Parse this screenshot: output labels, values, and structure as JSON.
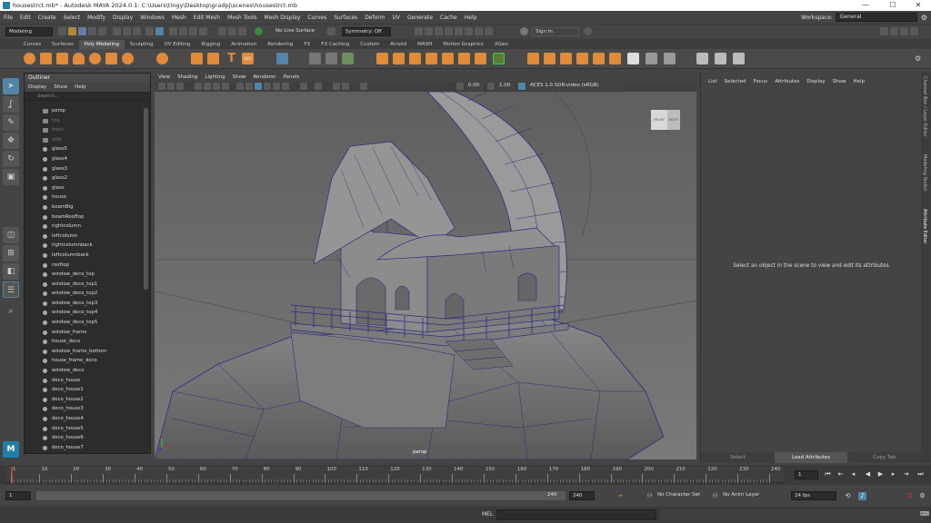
{
  "window": {
    "title": "housestrct.mb* - Autodesk MAYA 2024.0.1: C:\\Users\\tingy\\Desktop\\gradpj\\scenes\\housestrct.mb",
    "minimize": "—",
    "maximize": "☐",
    "close": "✕"
  },
  "menubar": [
    "File",
    "Edit",
    "Create",
    "Select",
    "Modify",
    "Display",
    "Windows",
    "Mesh",
    "Edit Mesh",
    "Mesh Tools",
    "Mesh Display",
    "Curves",
    "Surfaces",
    "Deform",
    "UV",
    "Generate",
    "Cache",
    "Help"
  ],
  "workspace": {
    "label": "Workspace:",
    "value": "General"
  },
  "statusline": {
    "menuset": "Modeling",
    "live_surface": "No Live Surface",
    "symmetry": "Symmetry: Off",
    "signin": "Sign In"
  },
  "shelf_tabs": [
    "Curves",
    "Surfaces",
    "Poly Modeling",
    "Sculpting",
    "UV Editing",
    "Rigging",
    "Animation",
    "Rendering",
    "FX",
    "FX Caching",
    "Custom",
    "Arnold",
    "MASH",
    "Motion Graphics",
    "XGen"
  ],
  "shelf_active": "Poly Modeling",
  "outliner": {
    "title": "Outliner",
    "menu": [
      "Display",
      "Show",
      "Help"
    ],
    "search_placeholder": "Search...",
    "cameras": [
      "persp",
      "top",
      "front",
      "side"
    ],
    "items": [
      "glass5",
      "glass4",
      "glass3",
      "glass2",
      "glass",
      "house",
      "beamBig",
      "beamRooftop",
      "rightcolumn",
      "leftcolumn",
      "rightcolumnback",
      "leftcolumnback",
      "rooftop",
      "window_deco_top",
      "window_deco_top1",
      "window_deco_top2",
      "window_deco_top3",
      "window_deco_top4",
      "window_deco_top5",
      "window_frame",
      "house_deco",
      "window_frame_bottom",
      "house_frame_deco",
      "window_deco",
      "deco_house",
      "deco_house1",
      "deco_house2",
      "deco_house3",
      "deco_house4",
      "deco_house5",
      "deco_house6",
      "deco_house7"
    ]
  },
  "viewport": {
    "menu": [
      "View",
      "Shading",
      "Lighting",
      "Show",
      "Renderer",
      "Panels"
    ],
    "exposure": "0.00",
    "gamma": "1.00",
    "colorspace": "ACES 1.0 SDR-video (sRGB)",
    "camera_label": "persp",
    "viewcube_front": "FRONT",
    "viewcube_right": "RIGHT"
  },
  "attribute_editor": {
    "menu": [
      "List",
      "Selected",
      "Focus",
      "Attributes",
      "Display",
      "Show",
      "Help"
    ],
    "message": "Select an object in the scene to view and edit its attributes",
    "buttons": [
      "Select",
      "Load Attributes",
      "Copy Tab"
    ]
  },
  "side_tabs": [
    "Channel Box / Layer Editor",
    "Modeling Toolkit",
    "Attribute Editor"
  ],
  "timeslider": {
    "ticks": [
      "1",
      "10",
      "20",
      "30",
      "40",
      "50",
      "60",
      "70",
      "80",
      "90",
      "100",
      "110",
      "120",
      "130",
      "140",
      "150",
      "160",
      "170",
      "180",
      "190",
      "200",
      "210",
      "220",
      "230",
      "240"
    ],
    "current_frame": "1"
  },
  "rangeslider": {
    "start": "1",
    "inner_start": "1",
    "inner_end": "240",
    "end": "240",
    "end2": "240",
    "character_set": "No Character Set",
    "anim_layer": "No Anim Layer",
    "fps": "24 fps"
  },
  "cmdline": {
    "label": "MEL"
  },
  "colors": {
    "accent_orange": "#e08a3a",
    "accent_blue": "#5285a6",
    "wire": "#2c2c80"
  }
}
